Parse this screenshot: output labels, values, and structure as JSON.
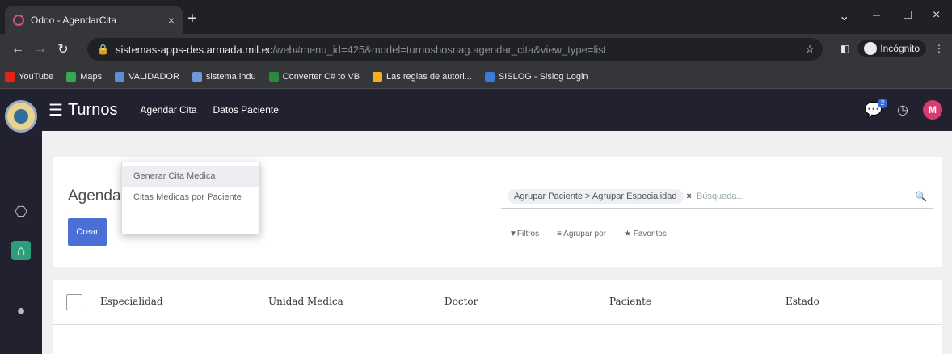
{
  "browser": {
    "tab_title": "Odoo - AgendarCita",
    "tab_close": "×",
    "new_tab": "+",
    "window_controls": [
      "⌄",
      "–",
      "□",
      "×"
    ],
    "url_host": "sistemas-apps-des.armada.mil.ec",
    "url_path": "/web#menu_id=425&model=turnoshosnag.agendar_cita&view_type=list",
    "profile_label": "Incógnito",
    "bookmarks": [
      {
        "label": "YouTube",
        "color": "#e62117"
      },
      {
        "label": "Maps",
        "color": "#34a853"
      },
      {
        "label": "VALIDADOR",
        "color": "#5b8dd9"
      },
      {
        "label": "sistema indu",
        "color": "#6b9bd9"
      },
      {
        "label": "Converter C# to VB",
        "color": "#2b8a3e"
      },
      {
        "label": "Las reglas de autori...",
        "color": "#f2b01e"
      },
      {
        "label": "SISLOG - Sislog Login",
        "color": "#3a7bd5"
      }
    ]
  },
  "app": {
    "title": "Turnos",
    "menu": [
      "Agendar Cita",
      "Datos Paciente"
    ],
    "avatar_letter": "M",
    "chat_badge": "2",
    "accent": "#4a6fd7",
    "nav_bg": "#212130"
  },
  "control": {
    "breadcrumb": "AgendarCi",
    "create_label": "Crear",
    "facet": "Agrupar Paciente > Agrupar Especialidad",
    "facet_close": "×",
    "search_placeholder": "Búsqueda...",
    "filters": [
      "▼Filtros",
      "≡ Agrupar por",
      "★ Favoritos"
    ]
  },
  "dropdown": {
    "items": [
      "Generar Cita Medica",
      "Citas Medicas por Paciente"
    ]
  },
  "list": {
    "columns": [
      "Especialidad",
      "Unidad Medica",
      "Doctor",
      "Paciente",
      "Estado"
    ]
  }
}
